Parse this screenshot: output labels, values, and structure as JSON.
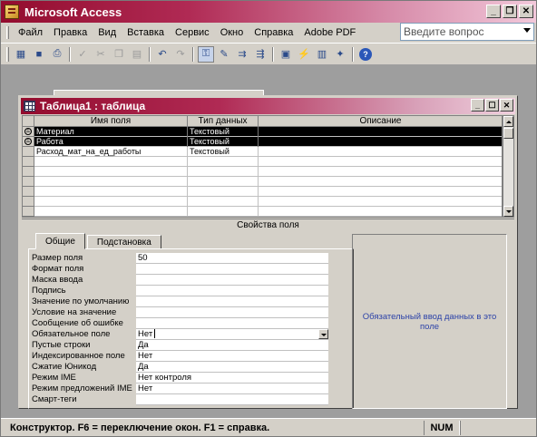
{
  "app": {
    "title": "Microsoft Access"
  },
  "window_buttons": {
    "minimize": "_",
    "restore": "❐",
    "close": "✕"
  },
  "menu": [
    "Файл",
    "Правка",
    "Вид",
    "Вставка",
    "Сервис",
    "Окно",
    "Справка",
    "Adobe PDF"
  ],
  "ask_box": {
    "placeholder": "Введите вопрос"
  },
  "toolbar_icons": [
    "view-icon",
    "save-icon",
    "print-icon",
    "spell-icon",
    "cut-icon",
    "copy-icon",
    "paste-icon",
    "undo-icon",
    "redo-icon",
    "key-icon",
    "builder-icon",
    "insert-rows-icon",
    "delete-rows-icon",
    "properties-icon",
    "indexes-icon",
    "database-window-icon",
    "new-object-icon",
    "help-icon"
  ],
  "doc_window": {
    "title": "Таблица1 : таблица"
  },
  "table": {
    "headers": [
      "Имя поля",
      "Тип данных",
      "Описание"
    ],
    "rows": [
      {
        "name": "Материал",
        "type": "Текстовый",
        "desc": "",
        "key": true
      },
      {
        "name": "Работа",
        "type": "Текстовый",
        "desc": "",
        "key": true
      },
      {
        "name": "Расход_мат_на_ед_работы",
        "type": "Текстовый",
        "desc": "",
        "key": false
      }
    ]
  },
  "props": {
    "title": "Свойства поля",
    "tabs": [
      "Общие",
      "Подстановка"
    ],
    "rows": [
      {
        "label": "Размер поля",
        "value": "50"
      },
      {
        "label": "Формат поля",
        "value": ""
      },
      {
        "label": "Маска ввода",
        "value": ""
      },
      {
        "label": "Подпись",
        "value": ""
      },
      {
        "label": "Значение по умолчанию",
        "value": ""
      },
      {
        "label": "Условие на значение",
        "value": ""
      },
      {
        "label": "Сообщение об ошибке",
        "value": ""
      },
      {
        "label": "Обязательное поле",
        "value": "Нет"
      },
      {
        "label": "Пустые строки",
        "value": "Да"
      },
      {
        "label": "Индексированное поле",
        "value": "Нет"
      },
      {
        "label": "Сжатие Юникод",
        "value": "Да"
      },
      {
        "label": "Режим IME",
        "value": "Нет контроля"
      },
      {
        "label": "Режим предложений IME",
        "value": "Нет"
      },
      {
        "label": "Смарт-теги",
        "value": ""
      }
    ],
    "hint": "Обязательный ввод данных в это поле"
  },
  "status": {
    "text": "Конструктор.  F6 = переключение окон.  F1 = справка.",
    "num": "NUM"
  },
  "colors": {
    "title_bar": "#930c2e",
    "chrome": "#d4d0c8",
    "workspace": "#9e9e9e",
    "hint_text": "#2d43a8"
  }
}
